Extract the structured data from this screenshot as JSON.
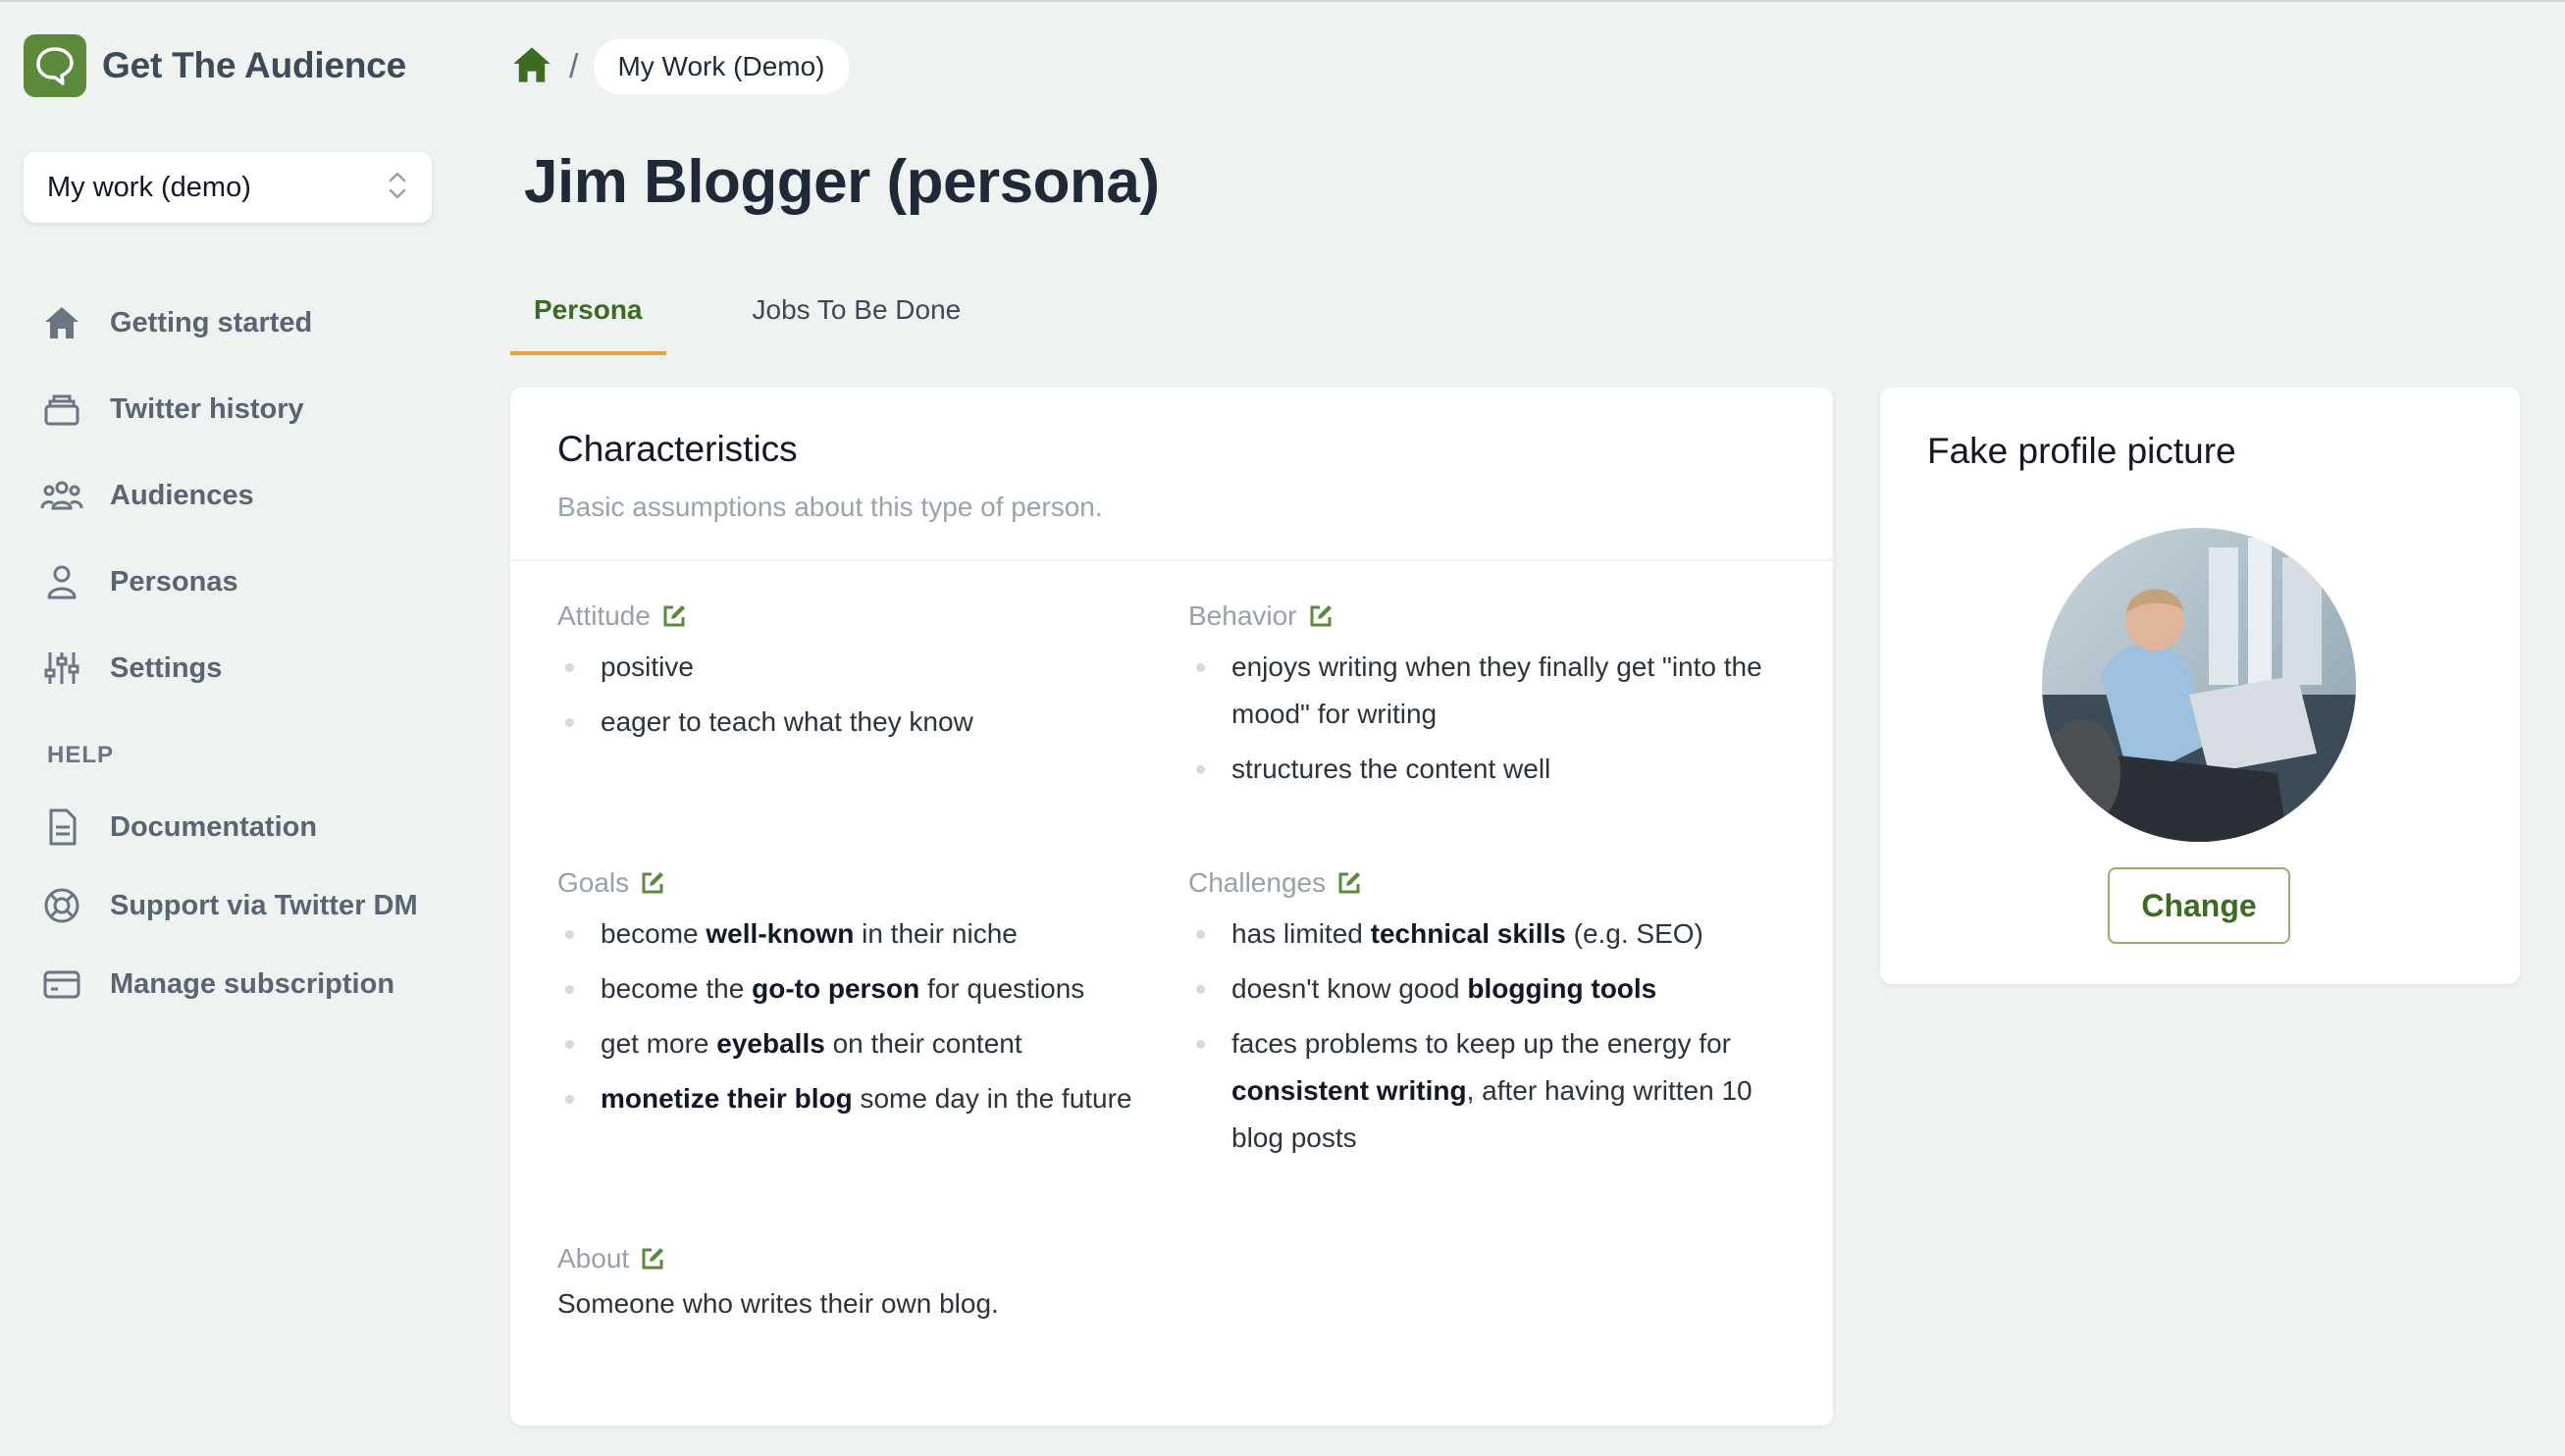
{
  "app": {
    "name": "Get The Audience"
  },
  "workspace": {
    "selected": "My work (demo)"
  },
  "sidebar": {
    "items": [
      {
        "label": "Getting started",
        "icon": "home-icon"
      },
      {
        "label": "Twitter history",
        "icon": "archive-icon"
      },
      {
        "label": "Audiences",
        "icon": "users-icon"
      },
      {
        "label": "Personas",
        "icon": "user-icon"
      },
      {
        "label": "Settings",
        "icon": "sliders-icon"
      }
    ],
    "help_heading": "HELP",
    "help_items": [
      {
        "label": "Documentation",
        "icon": "document-icon"
      },
      {
        "label": "Support via Twitter DM",
        "icon": "lifebuoy-icon"
      },
      {
        "label": "Manage subscription",
        "icon": "credit-card-icon"
      }
    ]
  },
  "breadcrumb": {
    "separator": "/",
    "current": "My Work (Demo)"
  },
  "page": {
    "title": "Jim Blogger (persona)"
  },
  "tabs": [
    {
      "label": "Persona",
      "active": true
    },
    {
      "label": "Jobs To Be Done",
      "active": false
    }
  ],
  "characteristics": {
    "title": "Characteristics",
    "subtitle": "Basic assumptions about this type of person.",
    "attitude": {
      "title": "Attitude",
      "items": [
        "positive",
        "eager to teach what they know"
      ]
    },
    "behavior": {
      "title": "Behavior",
      "items": [
        "enjoys writing when they finally get \"into the mood\" for writing",
        "structures the content well"
      ]
    },
    "goals": {
      "title": "Goals",
      "items": [
        {
          "pre": "become ",
          "bold": "well-known",
          "post": " in their niche"
        },
        {
          "pre": "become the ",
          "bold": "go-to person",
          "post": " for questions"
        },
        {
          "pre": "get more ",
          "bold": "eyeballs",
          "post": " on their content"
        },
        {
          "pre": "",
          "bold": "monetize their blog",
          "post": " some day in the future"
        }
      ]
    },
    "challenges": {
      "title": "Challenges",
      "items": [
        {
          "pre": "has limited ",
          "bold": "technical skills",
          "post": " (e.g. SEO)"
        },
        {
          "pre": "doesn't know good ",
          "bold": "blogging tools",
          "post": ""
        },
        {
          "pre": "faces problems to keep up the energy for ",
          "bold": "consistent writing",
          "post": ", after having written 10 blog posts"
        }
      ]
    },
    "about": {
      "title": "About",
      "text": "Someone who writes their own blog."
    }
  },
  "profile_picture": {
    "title": "Fake profile picture",
    "button": "Change"
  },
  "colors": {
    "accent": "#5b8a3a",
    "tab_underline": "#e8a34a",
    "background": "#eef3f1"
  }
}
